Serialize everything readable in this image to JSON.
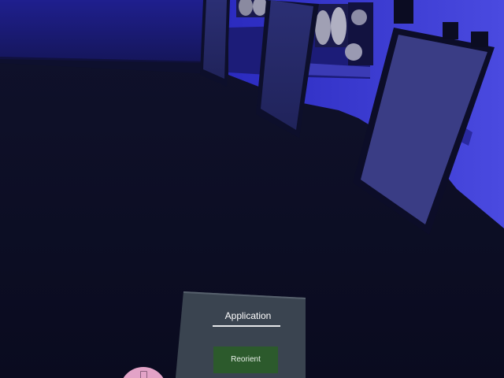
{
  "menu": {
    "title": "Application",
    "reorient_label": "Reorient"
  },
  "hand": {
    "icon": "tablet-icon"
  },
  "colors": {
    "floor": "#0b0d22",
    "wall": "#2a2ab0",
    "panel": "#3a4350",
    "button": "#2e5a2e",
    "hand": "#e7a3c8"
  }
}
